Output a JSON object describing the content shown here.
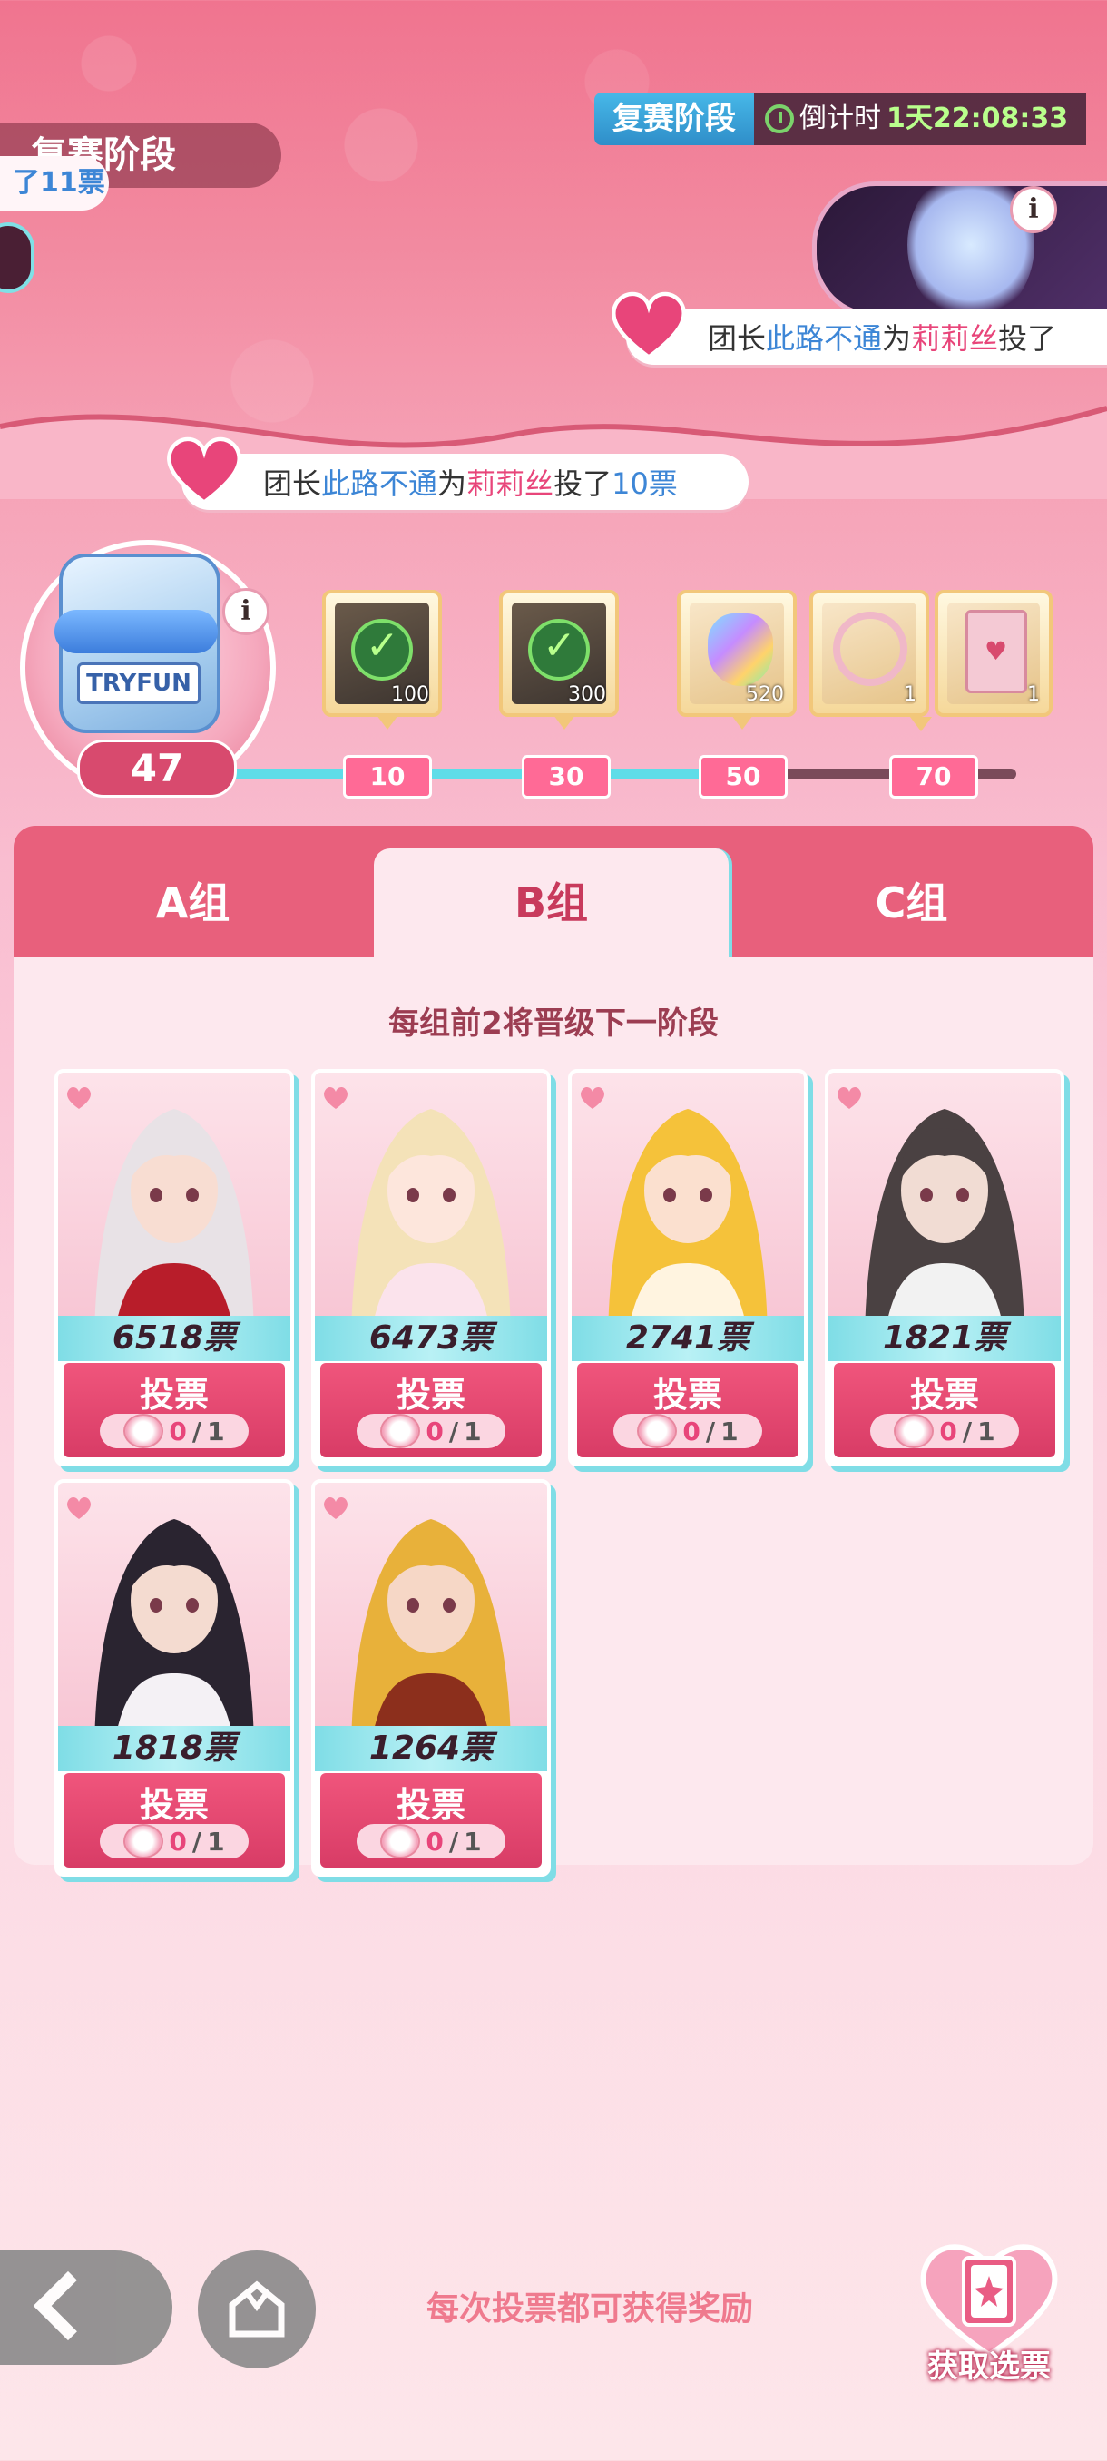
{
  "header": {
    "stage_title": "复赛阶段",
    "left_partial_votes": "了11票",
    "timer_stage": "复赛阶段",
    "timer_label": "倒计时",
    "timer_value": "1天22:08:33"
  },
  "ticker_top": {
    "prefix": "团长",
    "user": "此路不通",
    "mid": "为",
    "target": "莉莉丝",
    "suffix": "投了"
  },
  "ticker_main": {
    "prefix": "团长",
    "user": "此路不通",
    "mid": "为",
    "target": "莉莉丝",
    "action": "投了",
    "amount": "10票"
  },
  "progress": {
    "current": "47",
    "bottle_label": "TRYFUN",
    "fill_fraction": 0.64,
    "milestones": [
      "10",
      "30",
      "50",
      "70"
    ],
    "rewards": [
      {
        "icon": "green-check-gem-icon",
        "qty": "100"
      },
      {
        "icon": "green-check-gem-icon",
        "qty": "300"
      },
      {
        "icon": "rainbow-crystal-icon",
        "qty": "520"
      },
      {
        "icon": "flower-wreath-frame-icon",
        "qty": "1"
      },
      {
        "icon": "heart-card-icon",
        "qty": "1"
      }
    ]
  },
  "tabs": [
    "A组",
    "B组",
    "C组"
  ],
  "active_tab": "B组",
  "panel_note": "每组前2将晋级下一阶段",
  "cards": [
    {
      "votes": "6518票",
      "vote_label": "投票",
      "used": "0",
      "limit": "1",
      "hair": "#e8e2e6",
      "outfit": "#b81d2a",
      "skin": "#f8ddd2"
    },
    {
      "votes": "6473票",
      "vote_label": "投票",
      "used": "0",
      "limit": "1",
      "hair": "#f4e2b8",
      "outfit": "#fbe3ec",
      "skin": "#fde6dc"
    },
    {
      "votes": "2741票",
      "vote_label": "投票",
      "used": "0",
      "limit": "1",
      "hair": "#f5c23a",
      "outfit": "#fff4e0",
      "skin": "#fbe0cf"
    },
    {
      "votes": "1821票",
      "vote_label": "投票",
      "used": "0",
      "limit": "1",
      "hair": "#4a4142",
      "outfit": "#f2f2f2",
      "skin": "#f1dcd3"
    },
    {
      "votes": "1818票",
      "vote_label": "投票",
      "used": "0",
      "limit": "1",
      "hair": "#2a2430",
      "outfit": "#f4f1f5",
      "skin": "#f4dbd0"
    },
    {
      "votes": "1264票",
      "vote_label": "投票",
      "used": "0",
      "limit": "1",
      "hair": "#e8b13a",
      "outfit": "#8c2f1c",
      "skin": "#f6d7c6"
    }
  ],
  "bottom": {
    "note": "每次投票都可获得奖励",
    "get_votes": "获取选票"
  }
}
